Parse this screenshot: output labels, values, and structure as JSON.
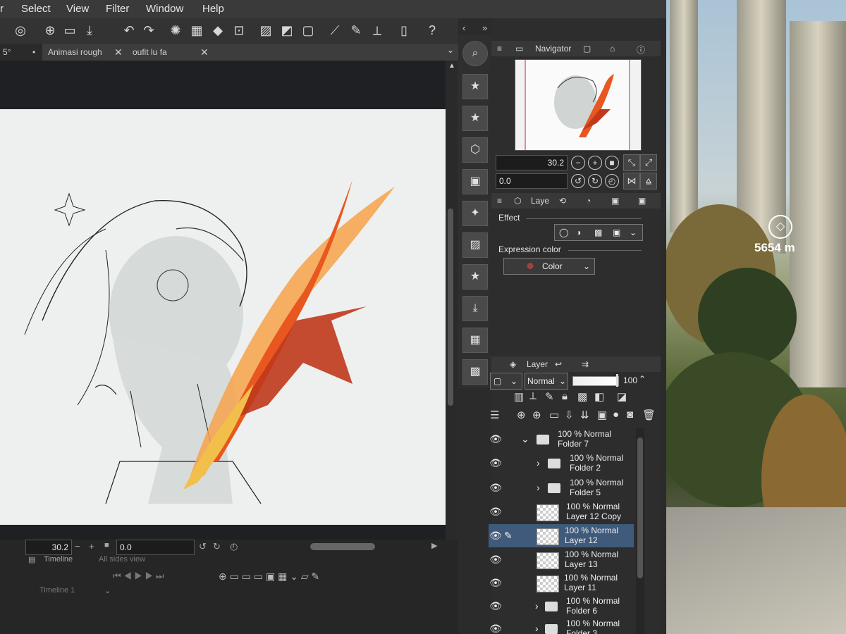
{
  "menu": {
    "items": [
      "r",
      "Select",
      "View",
      "Filter",
      "Window",
      "Help"
    ]
  },
  "tabs": [
    {
      "label": "5°",
      "active": true
    },
    {
      "label": "Animasi rough",
      "active": false
    },
    {
      "label": "oufit lu fa",
      "active": false
    }
  ],
  "timeline": {
    "zoom": "30.2",
    "rotation": "0.0",
    "label": "Timeline",
    "view_label": "All sides view",
    "track": "Timeline 1"
  },
  "navigator": {
    "title": "Navigator",
    "zoom": "30.2",
    "rotation": "0.0"
  },
  "layer_props": {
    "tab": "Laye",
    "effect_label": "Effect",
    "expression_label": "Expression color",
    "expression_value": "Color"
  },
  "layer_panel": {
    "tab": "Layer",
    "blend_mode": "Normal",
    "opacity": "100",
    "layers": [
      {
        "mode": "100 % Normal",
        "name": "Folder 7",
        "kind": "folder",
        "expanded": true
      },
      {
        "mode": "100 % Normal",
        "name": "Folder 2",
        "kind": "folder",
        "expanded": false
      },
      {
        "mode": "100 % Normal",
        "name": "Folder 5",
        "kind": "folder",
        "expanded": false
      },
      {
        "mode": "100 % Normal",
        "name": "Layer 12 Copy",
        "kind": "layer"
      },
      {
        "mode": "100 % Normal",
        "name": "Layer 12",
        "kind": "layer",
        "selected": true
      },
      {
        "mode": "100 % Normal",
        "name": "Layer 13",
        "kind": "layer"
      },
      {
        "mode": "100 % Normal",
        "name": "Layer 11",
        "kind": "layer"
      },
      {
        "mode": "100 % Normal",
        "name": "Folder 6",
        "kind": "folder",
        "expanded": false
      },
      {
        "mode": "100 % Normal",
        "name": "Folder 3",
        "kind": "folder",
        "expanded": false
      }
    ]
  },
  "hud": {
    "distance": "5654 m"
  },
  "colors": {
    "accent": "#3f5a7a",
    "flame": "#e8571f"
  }
}
